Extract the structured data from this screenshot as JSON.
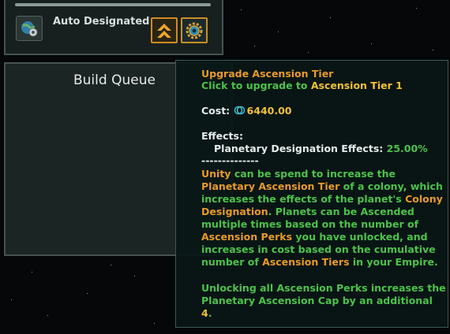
{
  "designation": {
    "label": "Auto Designated",
    "icon": "planet-gear-icon"
  },
  "buttons": {
    "upgrade_icon": "double-chevron-up-icon",
    "settings_icon": "gear-icon"
  },
  "build_queue": {
    "title": "Build Queue"
  },
  "tooltip": {
    "title": "Upgrade Ascension Tier",
    "click_prefix": "Click to upgrade to",
    "click_target": "Ascension Tier 1",
    "cost_label": "Cost:",
    "cost_value": "6440.00",
    "effects_label": "Effects:",
    "effect_name": "Planetary Designation Effects:",
    "effect_value": "25.00%",
    "separator": "--------------",
    "desc": {
      "l1a": "Unity",
      "l1b": " can be spend to increase the",
      "l2a": "Planetary Ascension Tier",
      "l2b": " of a colony, which",
      "l3a": "increases the effects of the planet's ",
      "l3b": "Colony",
      "l4a": "Designation",
      "l4b": ". Planets can be Ascended",
      "l5": "multiple times based on the number of",
      "l6a": "Ascension Perks",
      "l6b": " you have unlocked, and",
      "l7": "increases in cost based on the cumulative",
      "l8a": "number of ",
      "l8b": "Ascension Tiers",
      "l8c": " in your Empire."
    },
    "cap": {
      "l1": "Unlocking all Ascension Perks increases the",
      "l2": "Planetary Ascension Cap by an additional",
      "l3": "4",
      "l3b": "."
    }
  },
  "colors": {
    "orange": "#e89a28",
    "green": "#4cc24a",
    "yellow": "#f1c232",
    "panel": "#1b2523",
    "tooltip_bg": "#0a1616"
  }
}
